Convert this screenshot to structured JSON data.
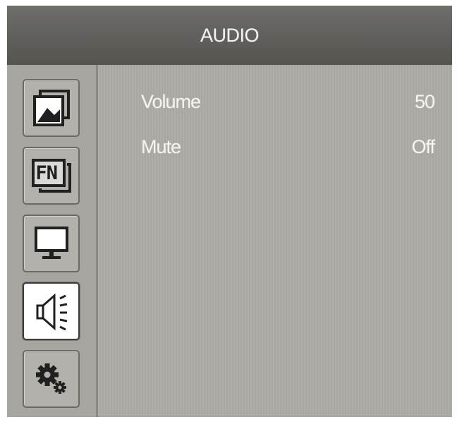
{
  "header": {
    "title": "AUDIO"
  },
  "sidebar": {
    "tabs": [
      {
        "icon": "picture-icon",
        "active": false
      },
      {
        "icon": "fn-icon",
        "label": "FN",
        "active": false
      },
      {
        "icon": "monitor-icon",
        "active": false
      },
      {
        "icon": "speaker-icon",
        "active": true
      },
      {
        "icon": "gears-icon",
        "active": false
      }
    ]
  },
  "menu": {
    "items": [
      {
        "label": "Volume",
        "value": "50"
      },
      {
        "label": "Mute",
        "value": "Off"
      }
    ]
  },
  "colors": {
    "header_bg": "#5f5e5a",
    "panel_bg": "#acaaa4",
    "text": "#f4f4f2",
    "active_tab_bg": "#ffffff"
  }
}
